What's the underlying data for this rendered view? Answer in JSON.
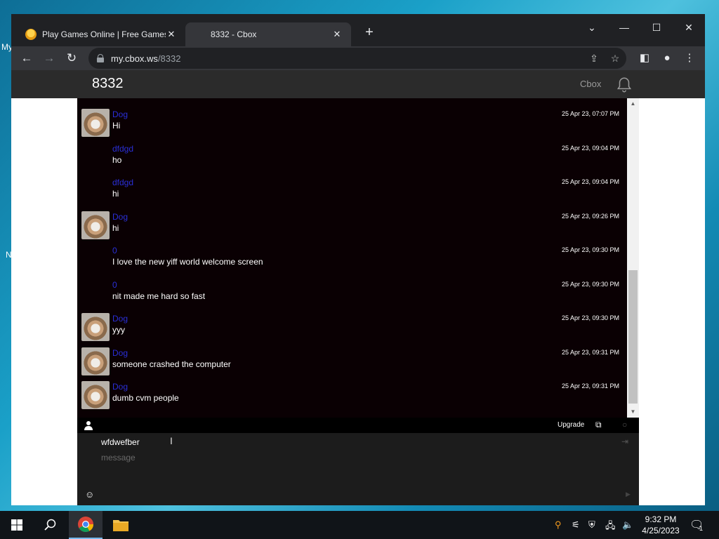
{
  "desktop": {
    "icon_label_1": "My",
    "icon_label_2": "N"
  },
  "browser": {
    "tabs": [
      {
        "title": "Play Games Online | Free Games",
        "active": false
      },
      {
        "title": "8332 - Cbox",
        "active": true
      }
    ],
    "new_tab": "+",
    "window_controls": {
      "dropdown": "⌄",
      "minimize": "—",
      "maximize": "☐",
      "close": "✕"
    },
    "url_host": "my.cbox.ws",
    "url_path": "/8332"
  },
  "cbox": {
    "title": "8332",
    "brand": "Cbox",
    "messages": [
      {
        "user": "Dog",
        "text": "Hi",
        "time": "25 Apr 23, 07:07 PM",
        "avatar": true
      },
      {
        "user": "dfdgd",
        "text": "ho",
        "time": "25 Apr 23, 09:04 PM",
        "avatar": false
      },
      {
        "user": "dfdgd",
        "text": "hi",
        "time": "25 Apr 23, 09:04 PM",
        "avatar": false
      },
      {
        "user": "Dog",
        "text": "hi",
        "time": "25 Apr 23, 09:26 PM",
        "avatar": true
      },
      {
        "user": "0",
        "text": "I love the new yiff world welcome screen",
        "time": "25 Apr 23, 09:30 PM",
        "avatar": false
      },
      {
        "user": "0",
        "text": "nit made me hard so fast",
        "time": "25 Apr 23, 09:30 PM",
        "avatar": false
      },
      {
        "user": "Dog",
        "text": "yyy",
        "time": "25 Apr 23, 09:30 PM",
        "avatar": true
      },
      {
        "user": "Dog",
        "text": "someone crashed the computer",
        "time": "25 Apr 23, 09:31 PM",
        "avatar": true
      },
      {
        "user": "Dog",
        "text": "dumb cvm people",
        "time": "25 Apr 23, 09:31 PM",
        "avatar": true
      }
    ],
    "upgrade_label": "Upgrade",
    "name_value": "wfdwefber",
    "message_placeholder": "message"
  },
  "taskbar": {
    "time": "9:32 PM",
    "date": "4/25/2023",
    "notification_count": "1"
  },
  "colors": {
    "username": "#2a2fd8",
    "chat_bg": "#0a0003",
    "header_bg": "#2b2b2b"
  }
}
